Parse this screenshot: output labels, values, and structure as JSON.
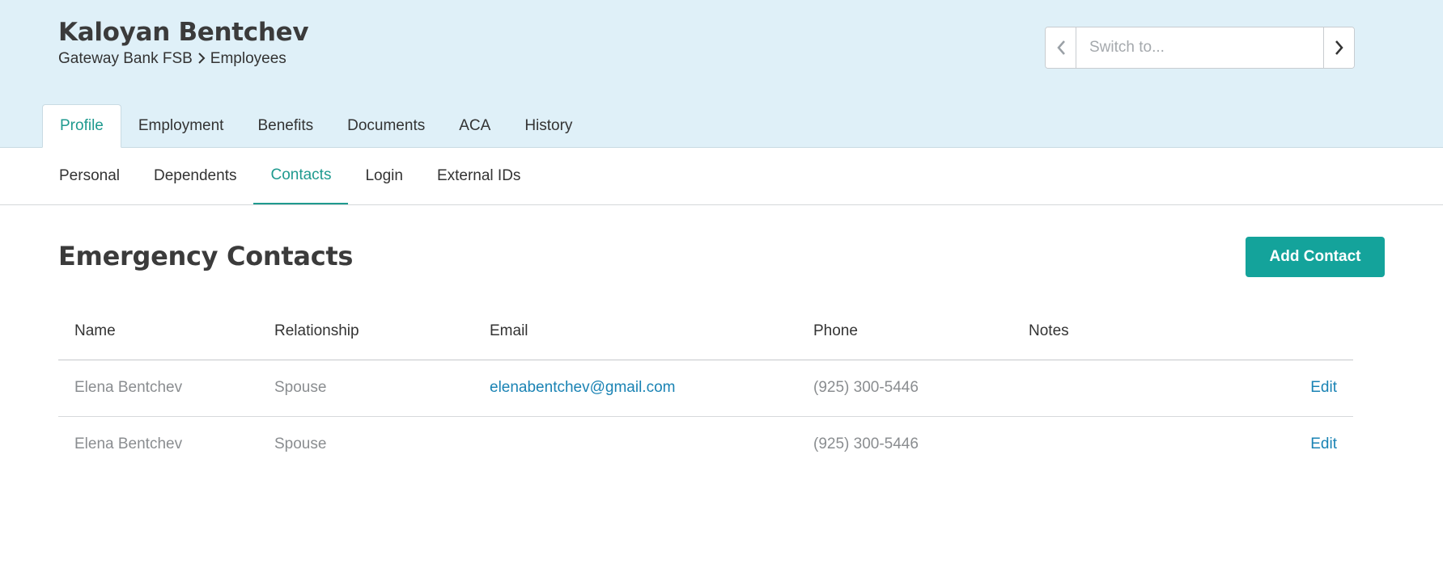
{
  "employee": {
    "name": "Kaloyan Bentchev",
    "company": "Gateway Bank FSB",
    "section": "Employees"
  },
  "switcher": {
    "placeholder": "Switch to..."
  },
  "main_tabs": [
    {
      "label": "Profile",
      "active": true
    },
    {
      "label": "Employment"
    },
    {
      "label": "Benefits"
    },
    {
      "label": "Documents"
    },
    {
      "label": "ACA"
    },
    {
      "label": "History"
    }
  ],
  "sub_tabs": [
    {
      "label": "Personal"
    },
    {
      "label": "Dependents"
    },
    {
      "label": "Contacts",
      "active": true
    },
    {
      "label": "Login"
    },
    {
      "label": "External IDs"
    }
  ],
  "contacts": {
    "title": "Emergency Contacts",
    "add_label": "Add Contact",
    "columns": [
      "Name",
      "Relationship",
      "Email",
      "Phone",
      "Notes"
    ],
    "rows": [
      {
        "name": "Elena Bentchev",
        "relationship": "Spouse",
        "email": "elenabentchev@gmail.com",
        "phone": "(925) 300-5446",
        "notes": "",
        "action": "Edit"
      },
      {
        "name": "Elena Bentchev",
        "relationship": "Spouse",
        "email": "",
        "phone": "(925) 300-5446",
        "notes": "",
        "action": "Edit"
      }
    ]
  },
  "colors": {
    "header_bg": "#dff0f8",
    "accent": "#1f9a8f",
    "button": "#14a39b",
    "link": "#1a83b4"
  },
  "icons": {
    "prev": "chevron-left-icon",
    "next": "chevron-right-icon",
    "breadcrumb_separator": "chevron-right-icon"
  }
}
